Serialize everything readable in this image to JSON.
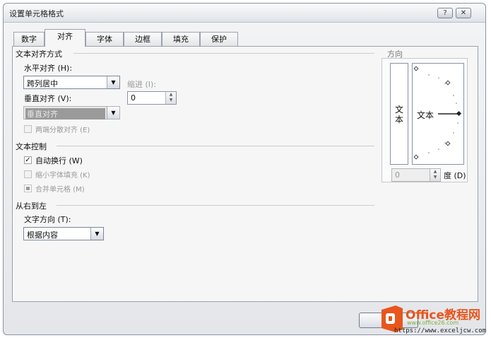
{
  "dialog": {
    "title": "设置单元格格式",
    "help_label": "?",
    "close_label": "✕"
  },
  "tabs": [
    {
      "label": "数字"
    },
    {
      "label": "对齐"
    },
    {
      "label": "字体"
    },
    {
      "label": "边框"
    },
    {
      "label": "填充"
    },
    {
      "label": "保护"
    }
  ],
  "text_alignment": {
    "section_title": "文本对齐方式",
    "horizontal_label": "水平对齐 (H):",
    "horizontal_value": "跨列居中",
    "indent_label": "缩进 (I):",
    "indent_value": "0",
    "vertical_label": "垂直对齐 (V):",
    "vertical_value": "垂直对齐",
    "justify_distributed_label": "两端分散对齐 (E)"
  },
  "text_control": {
    "section_title": "文本控制",
    "wrap_text_label": "自动换行 (W)",
    "shrink_to_fit_label": "缩小字体填充 (K)",
    "merge_cells_label": "合并单元格 (M)"
  },
  "rtl": {
    "section_title": "从右到左",
    "direction_label": "文字方向 (T):",
    "direction_value": "根据内容"
  },
  "orientation": {
    "section_title": "方向",
    "vertical_text": "文本",
    "dial_text": "文本",
    "degrees_value": "0",
    "degrees_label": "度 (D)"
  },
  "watermark": {
    "brand": "Office教程网",
    "url1": "www.office26.com",
    "url2": "https://www.exceljcw.com"
  }
}
